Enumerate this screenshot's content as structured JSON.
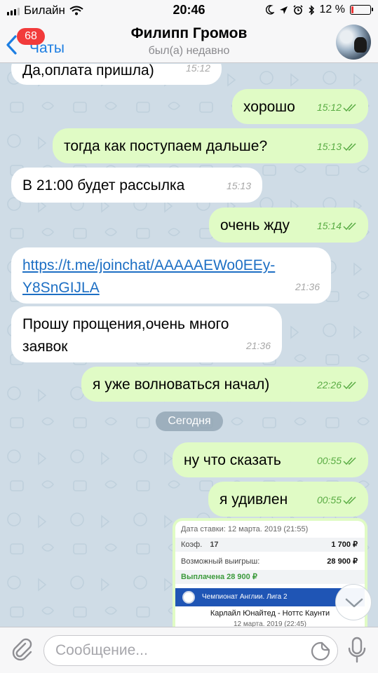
{
  "status_bar": {
    "carrier": "Билайн",
    "time": "20:46",
    "battery": "12 %",
    "battery_level": 0.12
  },
  "header": {
    "back_label": "Чаты",
    "unread_badge": "68",
    "contact_name": "Филипп Громов",
    "contact_status": "был(а) недавно"
  },
  "messages": [
    {
      "direction": "in",
      "text": "Да,оплата пришла)",
      "time": "15:12"
    },
    {
      "direction": "out",
      "text": "хорошо",
      "time": "15:12"
    },
    {
      "direction": "out",
      "text": "тогда как поступаем дальше?",
      "time": "15:13"
    },
    {
      "direction": "in",
      "text": "В 21:00 будет рассылка",
      "time": "15:13"
    },
    {
      "direction": "out",
      "text": "очень жду",
      "time": "15:14"
    },
    {
      "direction": "in",
      "link_line1": "https://t.me/joinchat/AAAAAEWo0EEy-",
      "link_line2": "Y8SnGIJLA",
      "time": "21:36"
    },
    {
      "direction": "in",
      "line1": "Прошу прощения,очень много",
      "line2": "заявок",
      "time": "21:36"
    },
    {
      "direction": "out",
      "text": "я уже волноваться начал)",
      "time": "22:26"
    },
    {
      "direction": "out",
      "text": "ну что сказать",
      "time": "00:55"
    },
    {
      "direction": "out",
      "text": "я удивлен",
      "time": "00:55"
    }
  ],
  "date_divider": "Сегодня",
  "bet_slip": {
    "bet_date": "Дата ставки: 12 марта. 2019 (21:55)",
    "coef_label": "Коэф.",
    "coef_value": "17",
    "stake": "1 700 ₽",
    "win_label": "Возможный выигрыш:",
    "win_value": "28 900 ₽",
    "paid": "Выплачена 28 900 ₽",
    "league": "Чемпионат Англии. Лига 2",
    "match": "Карлайл Юнайтед - Ноттс Каунти",
    "match_date": "12 марта. 2019 (22:45)"
  },
  "input": {
    "placeholder": "Сообщение..."
  },
  "colors": {
    "accent": "#1d7ee2",
    "outgoing_bubble": "#e0fbc5",
    "incoming_bubble": "#ffffff",
    "badge": "#f23b3b",
    "read_check": "#5aac44"
  },
  "icons": [
    "signal-icon",
    "wifi-icon",
    "moon-icon",
    "location-icon",
    "alarm-icon",
    "bluetooth-icon",
    "battery-icon",
    "back-chevron-icon",
    "double-check-icon",
    "chevron-down-icon",
    "paperclip-icon",
    "sticker-icon",
    "microphone-icon"
  ]
}
